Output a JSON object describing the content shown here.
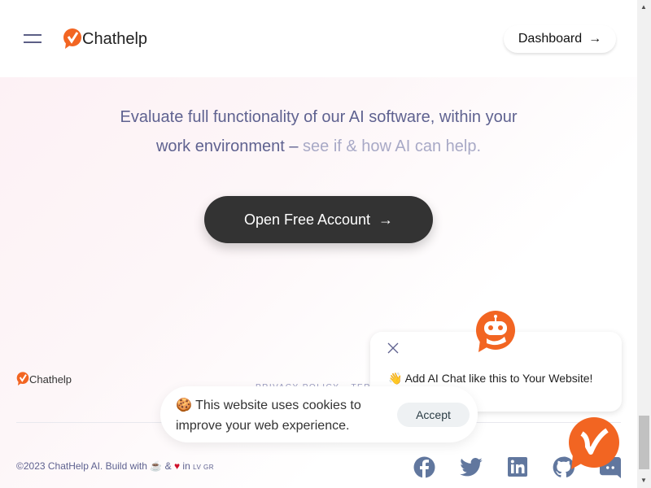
{
  "header": {
    "brand": "Chathelp",
    "dashboard_label": "Dashboard",
    "menu_icon": "hamburger-icon"
  },
  "hero": {
    "text_main": "Evaluate full functionality of our AI software, within your work environment –",
    "text_muted": "see if & how AI can help.",
    "cta_label": "Open Free Account"
  },
  "footer": {
    "brand": "Chathelp",
    "links": [
      "PRIVACY POLICY",
      "TERMS"
    ],
    "copyright": "©2023 ChatHelp AI. Build with",
    "and": "&",
    "in": "in",
    "langs": "LV GR",
    "social": [
      "facebook",
      "twitter",
      "linkedin",
      "github",
      "discord"
    ]
  },
  "cookie": {
    "text": "This website uses cookies to improve your web experience.",
    "accept_label": "Accept"
  },
  "chat_popup": {
    "message": "Add AI Chat like this to Your Website!"
  },
  "colors": {
    "brand": "#f26522",
    "text": "#5f6290",
    "social": "#61779e"
  }
}
